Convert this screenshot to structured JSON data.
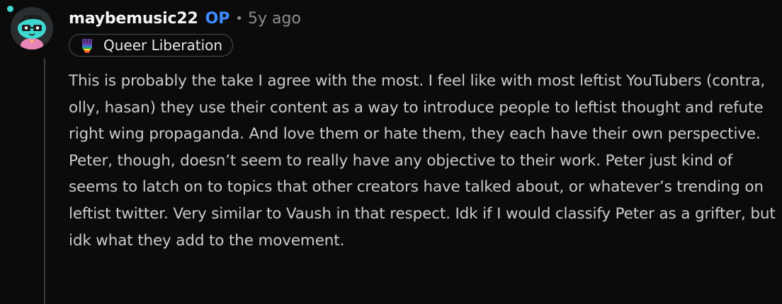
{
  "comment": {
    "author": "maybemusic22",
    "op_badge": "OP",
    "separator": "•",
    "timestamp": "5y ago",
    "flair": {
      "icon": "rainbow-fist-icon",
      "text": "Queer Liberation"
    },
    "body": "This is probably the take I agree with the most. I feel like with most leftist YouTubers (contra, olly, hasan) they use their content as a way to introduce people to leftist thought and refute right wing propaganda. And love them or hate them, they each have their own perspective. Peter, though, doesn’t seem to really have any objective to their work. Peter just kind of seems to latch on to topics that other creators have talked about, or whatever’s trending on leftist twitter. Very similar to Vaush in that respect. Idk if I would classify Peter as a grifter, but idk what they add to the movement."
  },
  "colors": {
    "background": "#0b0b0b",
    "op_badge": "#3d8bff",
    "thread_line": "#3a3d3f",
    "avatar_accent": "#3fd8d0"
  }
}
